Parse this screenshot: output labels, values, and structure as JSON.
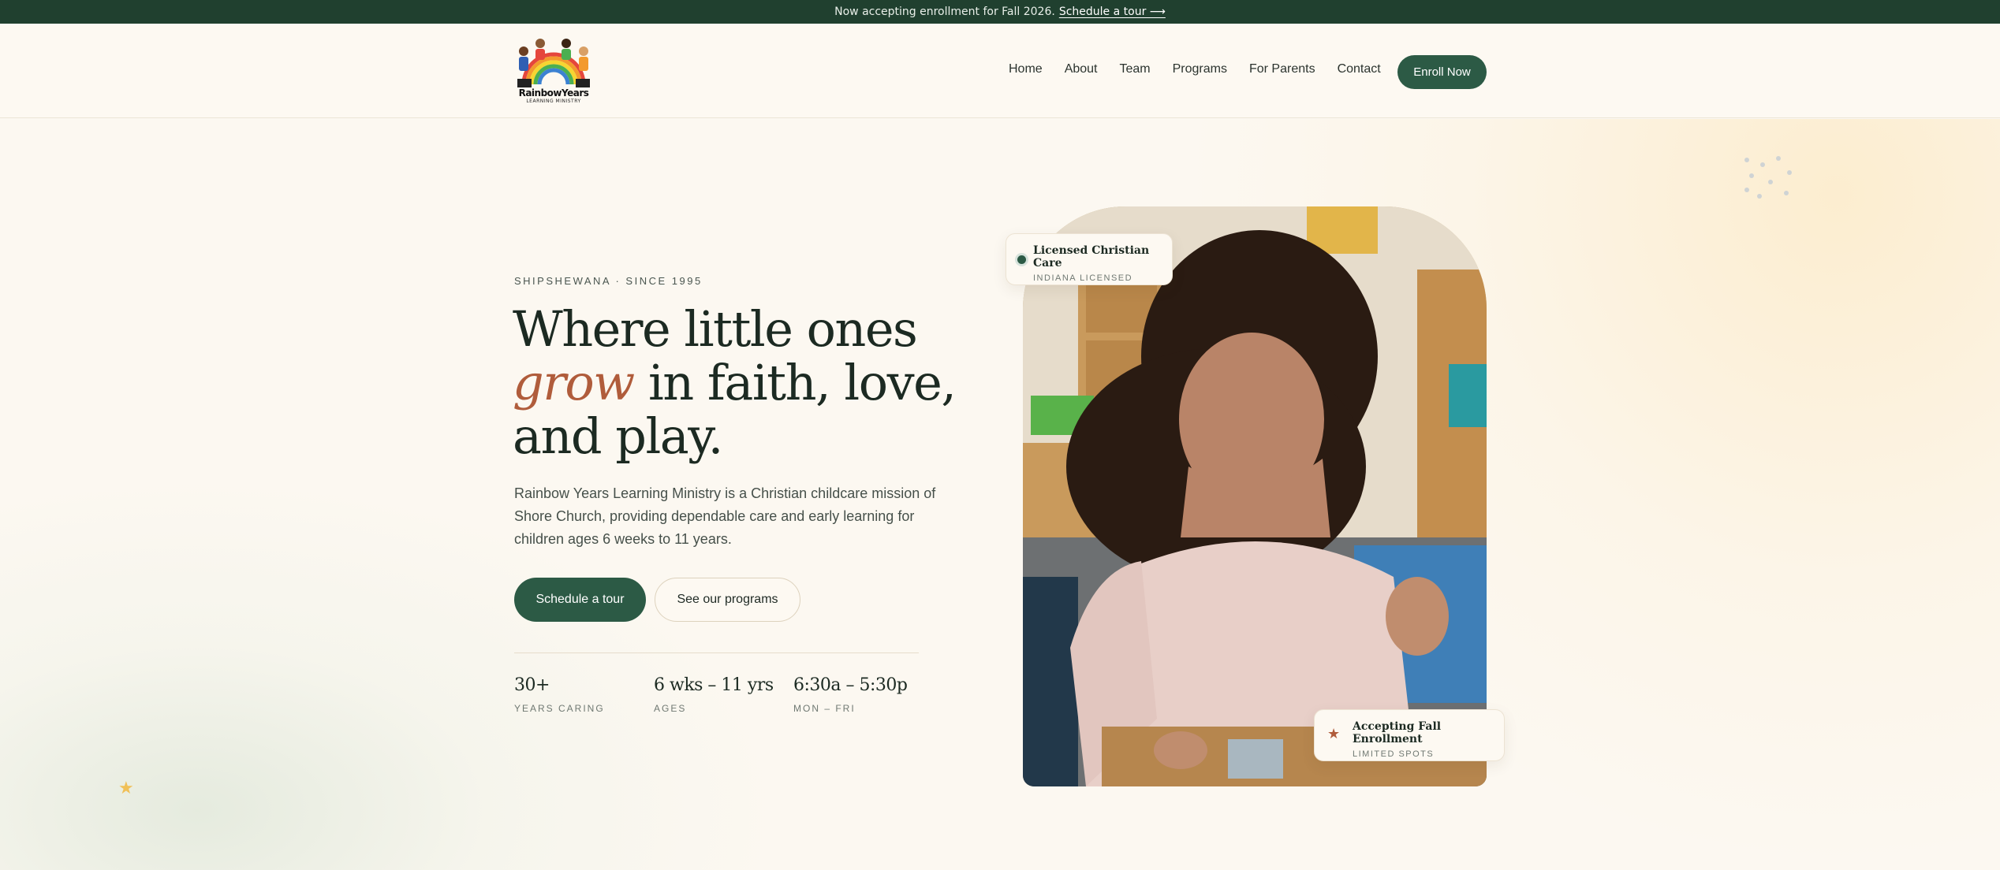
{
  "announcement": {
    "text": "Now accepting enrollment for Fall 2026.",
    "link": "Schedule a tour ⟶"
  },
  "brand": {
    "name": "RainbowYears",
    "tagline": "LEARNING MINISTRY"
  },
  "nav": {
    "items": [
      "Home",
      "About",
      "Team",
      "Programs",
      "For Parents",
      "Contact"
    ],
    "cta": "Enroll Now"
  },
  "hero": {
    "eyebrow": "SHIPSHEWANA · SINCE 1995",
    "headline": {
      "line1": "Where little ones",
      "accent": "grow",
      "line2_rest": " in faith, love,",
      "line3": "and play."
    },
    "lede": "Rainbow Years Learning Ministry is a Christian childcare mission of Shore Church, providing dependable care and early learning for children ages 6 weeks to 11 years.",
    "primary_cta": "Schedule a tour",
    "secondary_cta": "See our programs",
    "stats": [
      {
        "value": "30+",
        "label": "YEARS CARING"
      },
      {
        "value": "6 wks – 11 yrs",
        "label": "AGES"
      },
      {
        "value": "6:30a – 5:30p",
        "label": "MON – FRI"
      }
    ]
  },
  "badges": {
    "licensed": {
      "title": "Licensed Christian Care",
      "sub": "INDIANA LICENSED"
    },
    "enrollment": {
      "title": "Accepting Fall Enrollment",
      "sub": "LIMITED SPOTS"
    }
  },
  "colors": {
    "primary": "#2c5a45",
    "accent": "#b05c3b",
    "background": "#fcf8f1",
    "announcement_bg": "#20402f"
  },
  "icons": {
    "licensed_badge": "status-dot-icon",
    "enrollment_badge": "star-icon",
    "decor": [
      "dot-cluster-icon",
      "star-icon"
    ]
  }
}
